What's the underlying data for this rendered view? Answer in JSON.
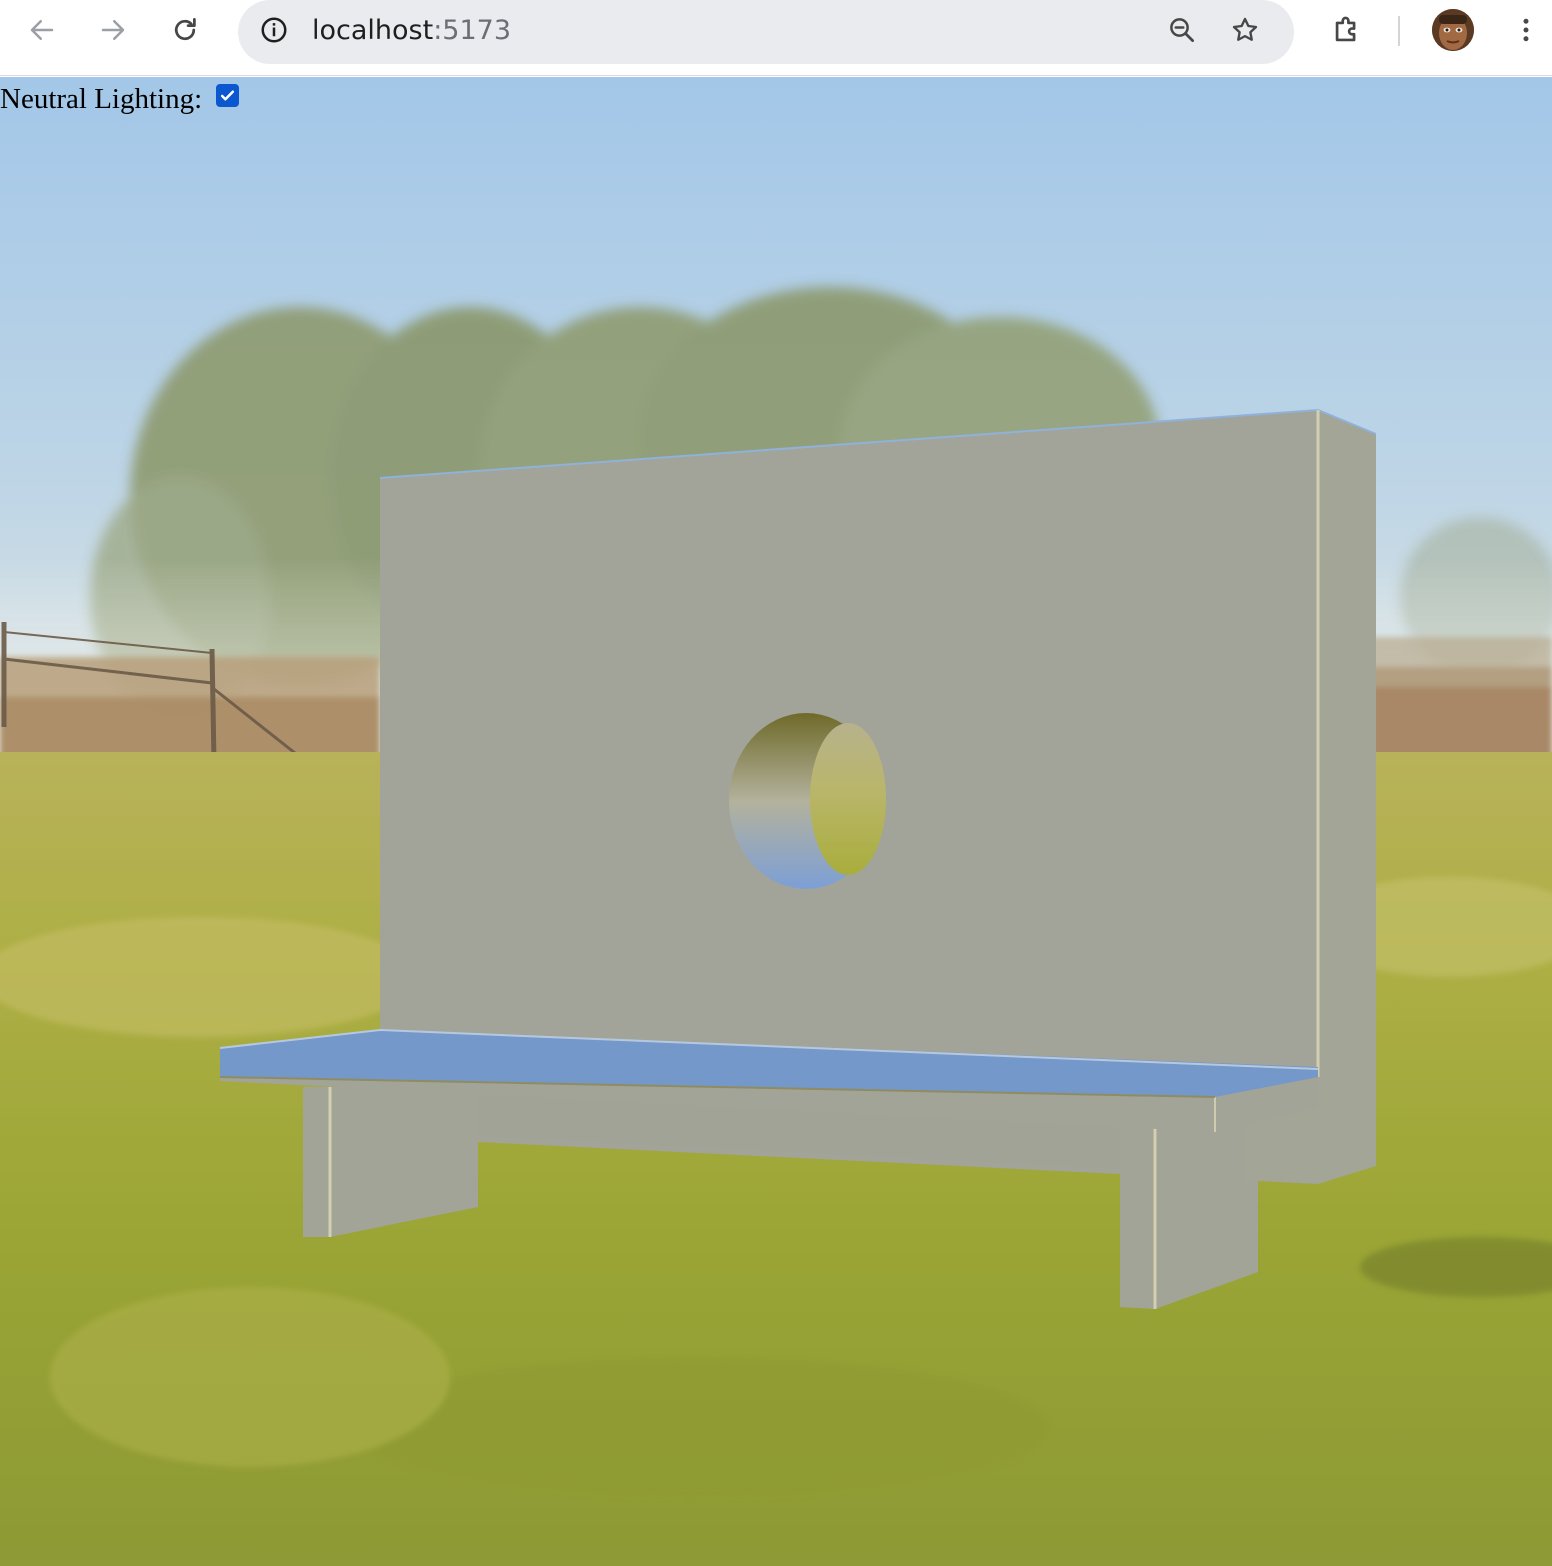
{
  "browser": {
    "url_host": "localhost",
    "url_port": ":5173",
    "icons": {
      "back": "arrow-left-icon",
      "forward": "arrow-right-icon",
      "reload": "reload-icon",
      "site_info": "info-icon",
      "zoom": "zoom-out-icon",
      "bookmark": "star-icon",
      "extensions": "puzzle-piece-icon",
      "profile": "avatar-icon",
      "menu": "kebab-menu-icon"
    }
  },
  "controls": {
    "neutral_lighting_label": "Neutral Lighting:",
    "neutral_lighting_checked": true
  },
  "scene": {
    "object": "bench-with-circular-hole-backrest",
    "colors": {
      "sky_top": "#a9cbe8",
      "sky_bottom": "#d8e4ea",
      "grass": "#a9ad3c",
      "panel": "#a2a49a",
      "seat_top": "#7599c9",
      "accent": "#0b57d0"
    }
  }
}
